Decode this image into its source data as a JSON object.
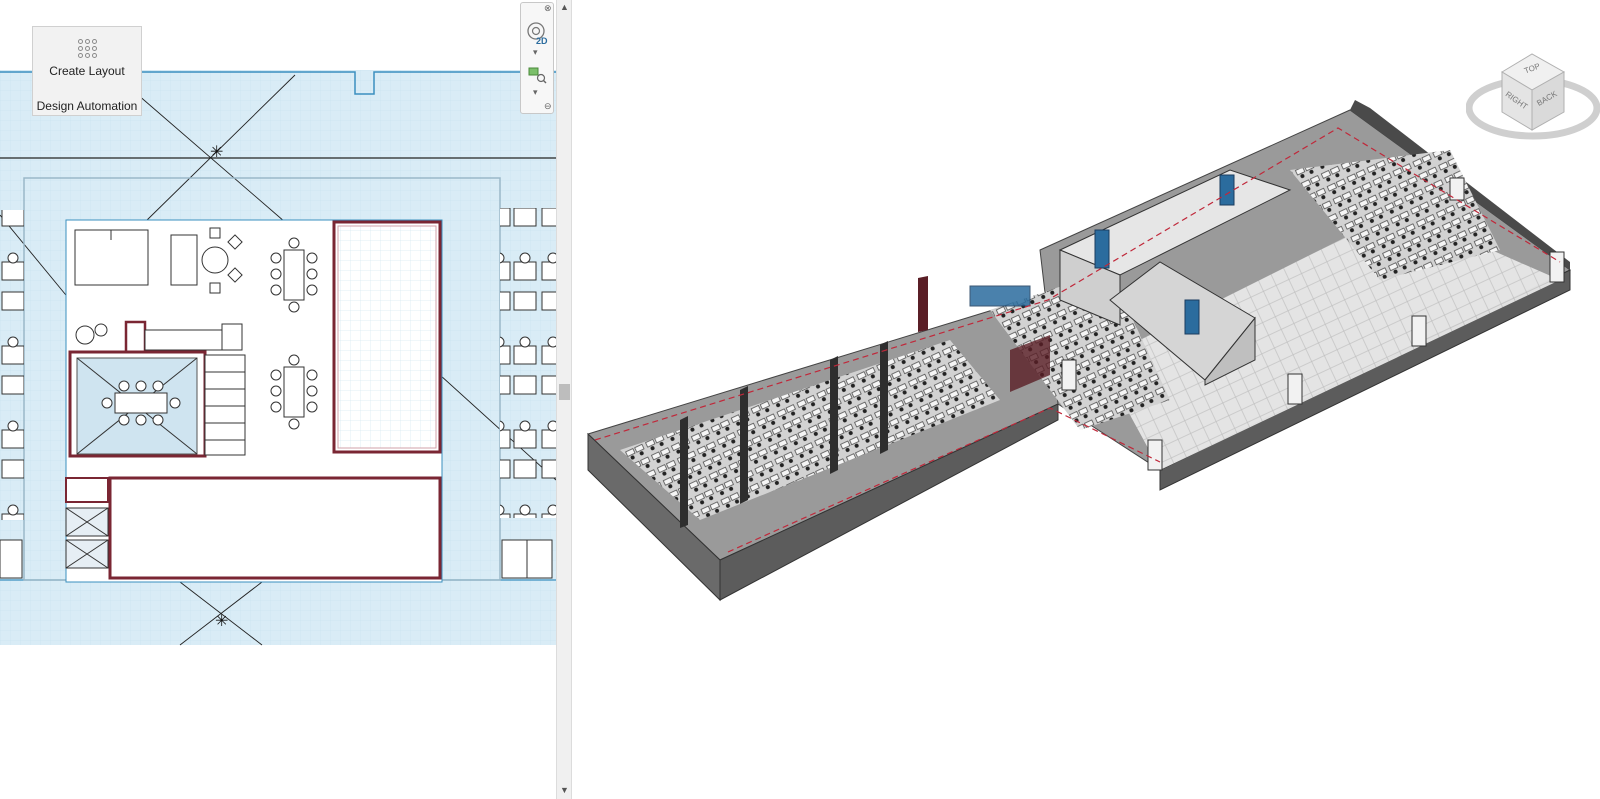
{
  "ribbon": {
    "create_layout_label": "Create Layout",
    "panel_title": "Design Automation",
    "icon": "grid-dots-icon"
  },
  "navigation_bar": {
    "mode_2d_label": "2D",
    "icons": [
      "steering-wheel-icon",
      "zoom-region-icon",
      "close-icon",
      "collapse-icon"
    ]
  },
  "viewcube": {
    "faces": [
      "TOP",
      "RIGHT",
      "BACK"
    ]
  },
  "colors": {
    "plan_fill": "#d9ecf6",
    "room_wall": "#7a2633",
    "model_floor": "#8e8e8e",
    "model_wall": "#d8d8d8",
    "accent_blue": "#2b6c9e",
    "bounds_red": "#c0283a"
  }
}
